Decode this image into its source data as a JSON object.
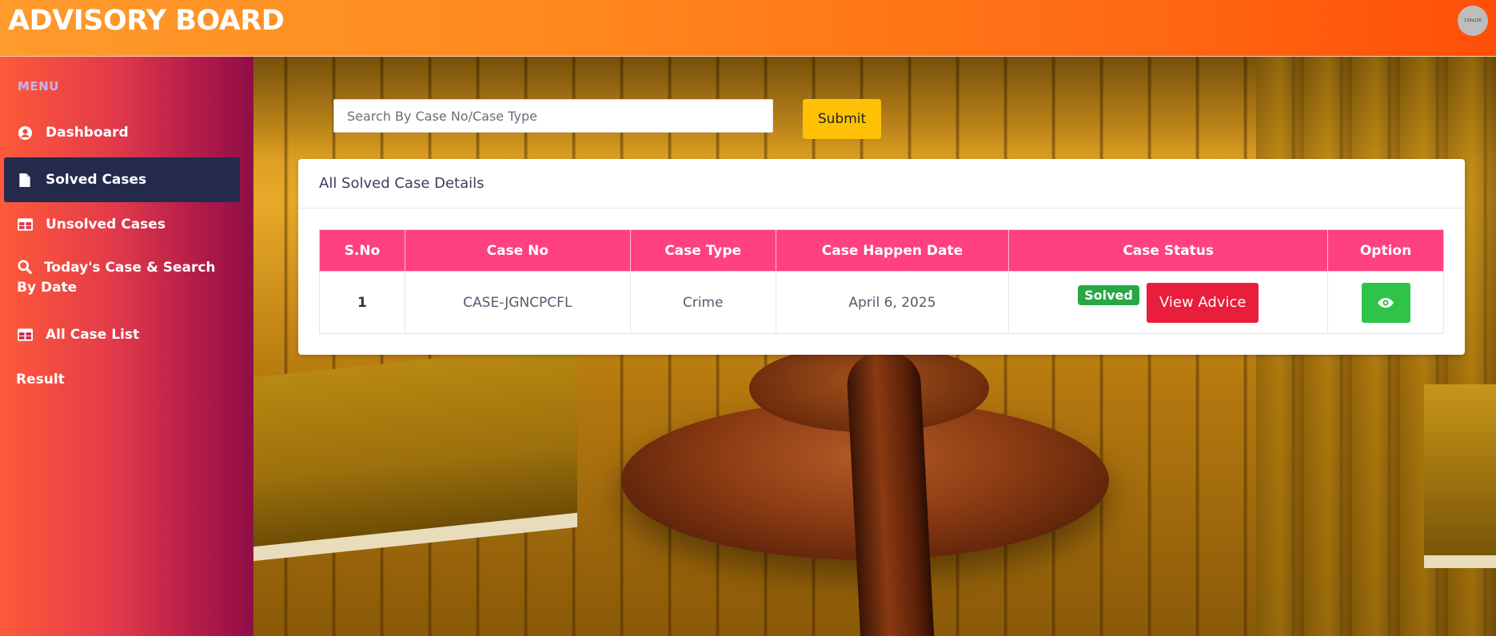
{
  "header": {
    "brand": "ADVISORY BOARD",
    "avatar_text": "120x120"
  },
  "sidebar": {
    "menu_title": "MENU",
    "items": [
      {
        "label": "Dashboard",
        "icon": "user-circle-icon",
        "active": false
      },
      {
        "label": "Solved Cases",
        "icon": "file-icon",
        "active": true
      },
      {
        "label": "Unsolved Cases",
        "icon": "table-icon",
        "active": false
      },
      {
        "label": "Today's Case & Search By Date",
        "icon": "search-icon",
        "active": false
      },
      {
        "label": "All Case List",
        "icon": "table-icon",
        "active": false
      },
      {
        "label": "Result",
        "icon": "",
        "active": false
      }
    ]
  },
  "search": {
    "placeholder": "Search By Case No/Case Type",
    "value": "",
    "submit_label": "Submit"
  },
  "card": {
    "title": "All Solved Case Details",
    "columns": [
      "S.No",
      "Case No",
      "Case Type",
      "Case Happen Date",
      "Case Status",
      "Option"
    ],
    "rows": [
      {
        "sno": "1",
        "case_no": "CASE-JGNCPCFL",
        "case_type": "Crime",
        "date": "April 6, 2025",
        "status": "Solved",
        "advice_label": "View Advice",
        "option_icon": "eye-icon"
      }
    ]
  },
  "colors": {
    "header_accent": "#ff7a1a",
    "table_header": "#ff4081",
    "status_solved": "#28a745",
    "advice_button": "#e81e3c",
    "submit_button": "#ffc107",
    "active_nav": "#242a4b"
  }
}
